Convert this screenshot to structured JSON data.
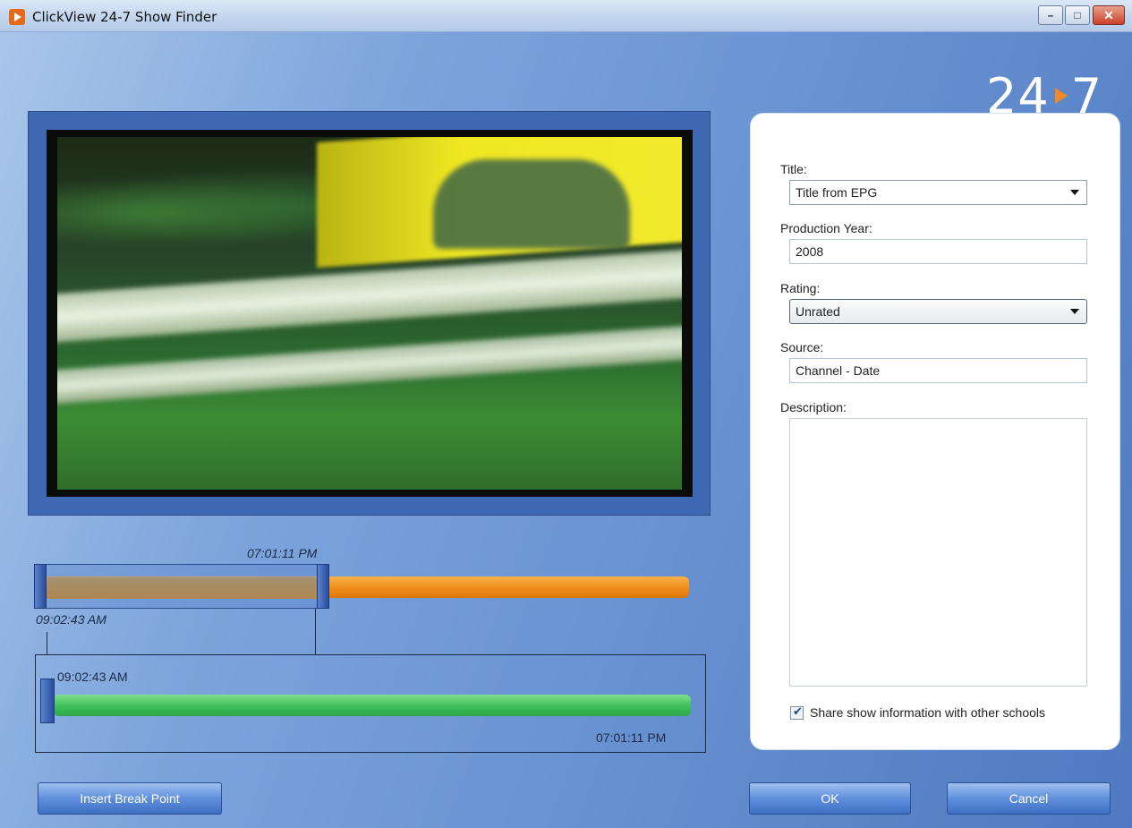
{
  "window": {
    "title": "ClickView 24-7 Show Finder",
    "controls": {
      "minimize": "–",
      "maximize": "□",
      "close": "✕"
    }
  },
  "logo": {
    "left": "24",
    "right": "7"
  },
  "timeline": {
    "overview": {
      "selection_end_label": "07:01:11 PM",
      "selection_start_label": "09:02:43 AM"
    },
    "zoom": {
      "start_label": "09:02:43 AM",
      "end_label": "07:01:11 PM"
    }
  },
  "form": {
    "title_label": "Title:",
    "title_value": "Title from EPG",
    "year_label": "Production Year:",
    "year_value": "2008",
    "rating_label": "Rating:",
    "rating_value": "Unrated",
    "source_label": "Source:",
    "source_value": "Channel - Date",
    "description_label": "Description:",
    "description_value": "",
    "share_label": "Share show information with other schools",
    "share_checked": true
  },
  "buttons": {
    "insert_break": "Insert Break Point",
    "ok": "OK",
    "cancel": "Cancel"
  },
  "colors": {
    "accent_orange": "#ee8a16",
    "accent_green": "#3fbf5a",
    "panel_blue": "#3f68b3"
  }
}
